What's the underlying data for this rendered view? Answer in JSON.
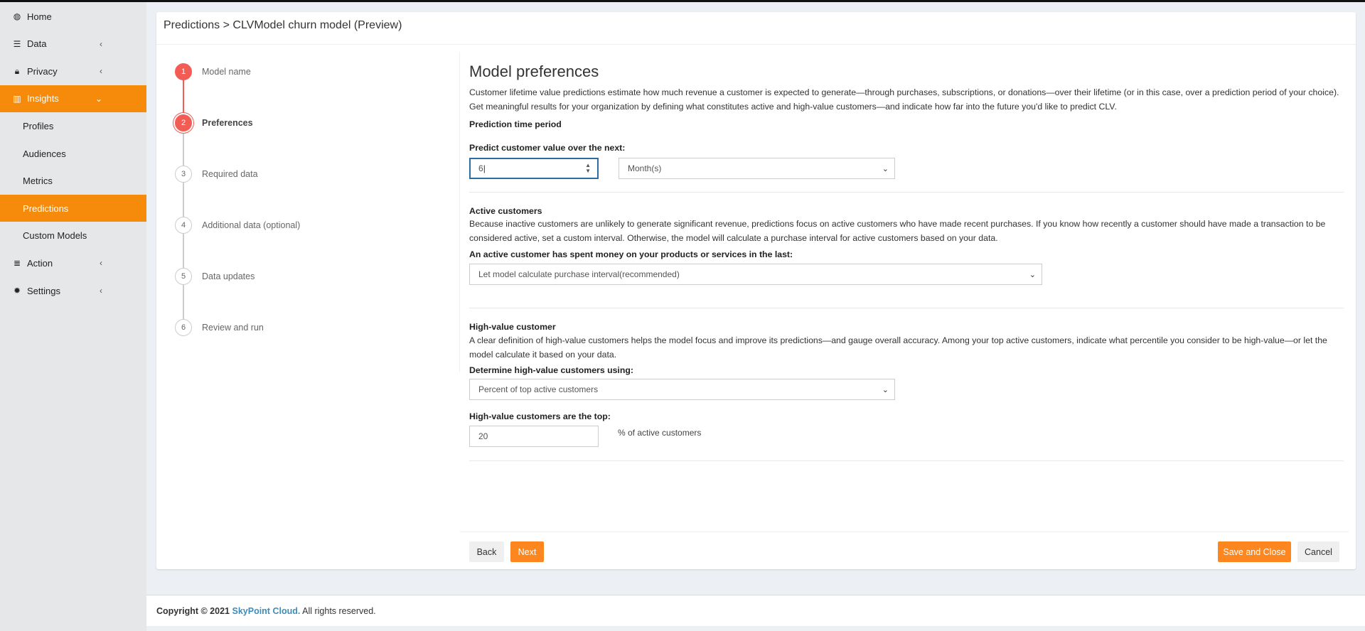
{
  "sidebar": {
    "items": [
      {
        "label": "Home",
        "icon": "dashboard-icon",
        "chevron": ""
      },
      {
        "label": "Data",
        "icon": "database-icon",
        "chevron": "‹"
      },
      {
        "label": "Privacy",
        "icon": "lock-icon",
        "chevron": "‹"
      },
      {
        "label": "Insights",
        "icon": "bar-chart-icon",
        "chevron": "⌄",
        "active": true
      },
      {
        "label": "Profiles",
        "sub": true
      },
      {
        "label": "Audiences",
        "sub": true
      },
      {
        "label": "Metrics",
        "sub": true
      },
      {
        "label": "Predictions",
        "sub": true,
        "active": true
      },
      {
        "label": "Custom Models",
        "sub": true
      },
      {
        "label": "Action",
        "icon": "list-icon",
        "chevron": "‹"
      },
      {
        "label": "Settings",
        "icon": "gear-icon",
        "chevron": "‹"
      }
    ]
  },
  "header": {
    "breadcrumb": "Predictions > CLVModel churn model (Preview)"
  },
  "steps": [
    {
      "num": "1",
      "label": "Model name",
      "state": "done"
    },
    {
      "num": "2",
      "label": "Preferences",
      "state": "current"
    },
    {
      "num": "3",
      "label": "Required data",
      "state": "pending"
    },
    {
      "num": "4",
      "label": "Additional data (optional)",
      "state": "pending"
    },
    {
      "num": "5",
      "label": "Data updates",
      "state": "pending"
    },
    {
      "num": "6",
      "label": "Review and run",
      "state": "pending"
    }
  ],
  "main": {
    "title": "Model preferences",
    "intro": "Customer lifetime value predictions estimate how much revenue a customer is expected to generate—through purchases, subscriptions, or donations—over their lifetime (or in this case, over a prediction period of your choice). Get meaningful results for your organization by defining what constitutes active and high-value customers—and indicate how far into the future you'd like to predict CLV.",
    "period_heading": "Prediction time period",
    "period_label": "Predict customer value over the next:",
    "period_value": "6",
    "period_unit": "Month(s)",
    "active_heading": "Active customers",
    "active_text": "Because inactive customers are unlikely to generate significant revenue, predictions focus on active customers who have made recent purchases. If you know how recently a customer should have made a transaction to be considered active, set a custom interval. Otherwise, the model will calculate a purchase interval for active customers based on your data.",
    "active_label": "An active customer has spent money on your products or services in the last:",
    "active_value": "Let model calculate purchase interval(recommended)",
    "hv_heading": "High-value customer",
    "hv_text": "A clear definition of high-value customers helps the model focus and improve its predictions—and gauge overall accuracy. Among your top active customers, indicate what percentile you consider to be high-value—or let the model calculate it based on your data.",
    "hv_method_label": "Determine high-value customers using:",
    "hv_method_value": "Percent of top active customers",
    "hv_top_label": "High-value customers are the top:",
    "hv_top_value": "20",
    "hv_top_suffix": "% of active customers"
  },
  "buttons": {
    "back": "Back",
    "next": "Next",
    "save": "Save and Close",
    "cancel": "Cancel"
  },
  "footer": {
    "prefix": "Copyright © 2021",
    "brand": "SkyPoint Cloud.",
    "suffix": " All rights reserved."
  },
  "colors": {
    "accent": "#f68a0b",
    "step": "#f25c54",
    "link": "#3c8dbc"
  }
}
